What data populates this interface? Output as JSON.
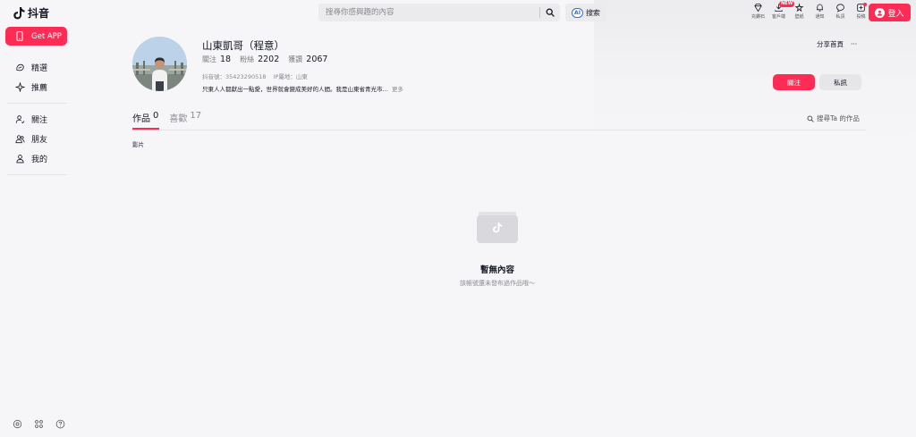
{
  "app": {
    "logo_text": "抖音"
  },
  "search": {
    "placeholder": "搜尋你感興趣的內容",
    "ai_badge": "AI",
    "ai_label": "搜索"
  },
  "top_icons": [
    {
      "label": "充鑽石",
      "icon": "diamond-icon"
    },
    {
      "label": "客戶端",
      "icon": "download-icon",
      "badge": "NEW"
    },
    {
      "label": "壁紙",
      "icon": "wallpaper-icon"
    },
    {
      "label": "通知",
      "icon": "bell-icon"
    },
    {
      "label": "私訊",
      "icon": "message-icon"
    },
    {
      "label": "投稿",
      "icon": "upload-icon"
    }
  ],
  "login": {
    "label": "登入"
  },
  "sidebar": {
    "get_app": "Get APP",
    "group1": [
      {
        "label": "精選",
        "icon": "featured-icon"
      },
      {
        "label": "推薦",
        "icon": "recommend-icon"
      }
    ],
    "group2": [
      {
        "label": "關注",
        "icon": "follow-icon"
      },
      {
        "label": "朋友",
        "icon": "friends-icon"
      },
      {
        "label": "我的",
        "icon": "me-icon"
      }
    ],
    "bottom_icons": [
      "settings-icon",
      "apps-icon",
      "help-icon"
    ]
  },
  "profile": {
    "name": "山東凱哥（程意）",
    "stats": [
      {
        "label": "關注",
        "value": "18"
      },
      {
        "label": "粉絲",
        "value": "2202"
      },
      {
        "label": "獲讚",
        "value": "2067"
      }
    ],
    "douyin_id": "抖音號：35423290518",
    "ip_location": "IP屬地：山東",
    "bio": "只東人人都獻出一點愛，世界就會變成美好的人間。我是山東省青光市…",
    "bio_more": "更多",
    "share_label": "分享首頁",
    "more_label": "···",
    "follow_label": "關注",
    "message_label": "私訊"
  },
  "tabs": [
    {
      "label": "作品",
      "count": "0"
    },
    {
      "label": "喜歡",
      "count": "17"
    }
  ],
  "works_search": "搜尋Ta 的作品",
  "sub_label": "影片",
  "empty": {
    "title": "暫無內容",
    "subtitle": "該帳號還未發布過作品哦～"
  },
  "colors": {
    "accent": "#fe2c55",
    "text": "#161823",
    "muted": "#8a8b91",
    "background": "#f6f6f8"
  }
}
